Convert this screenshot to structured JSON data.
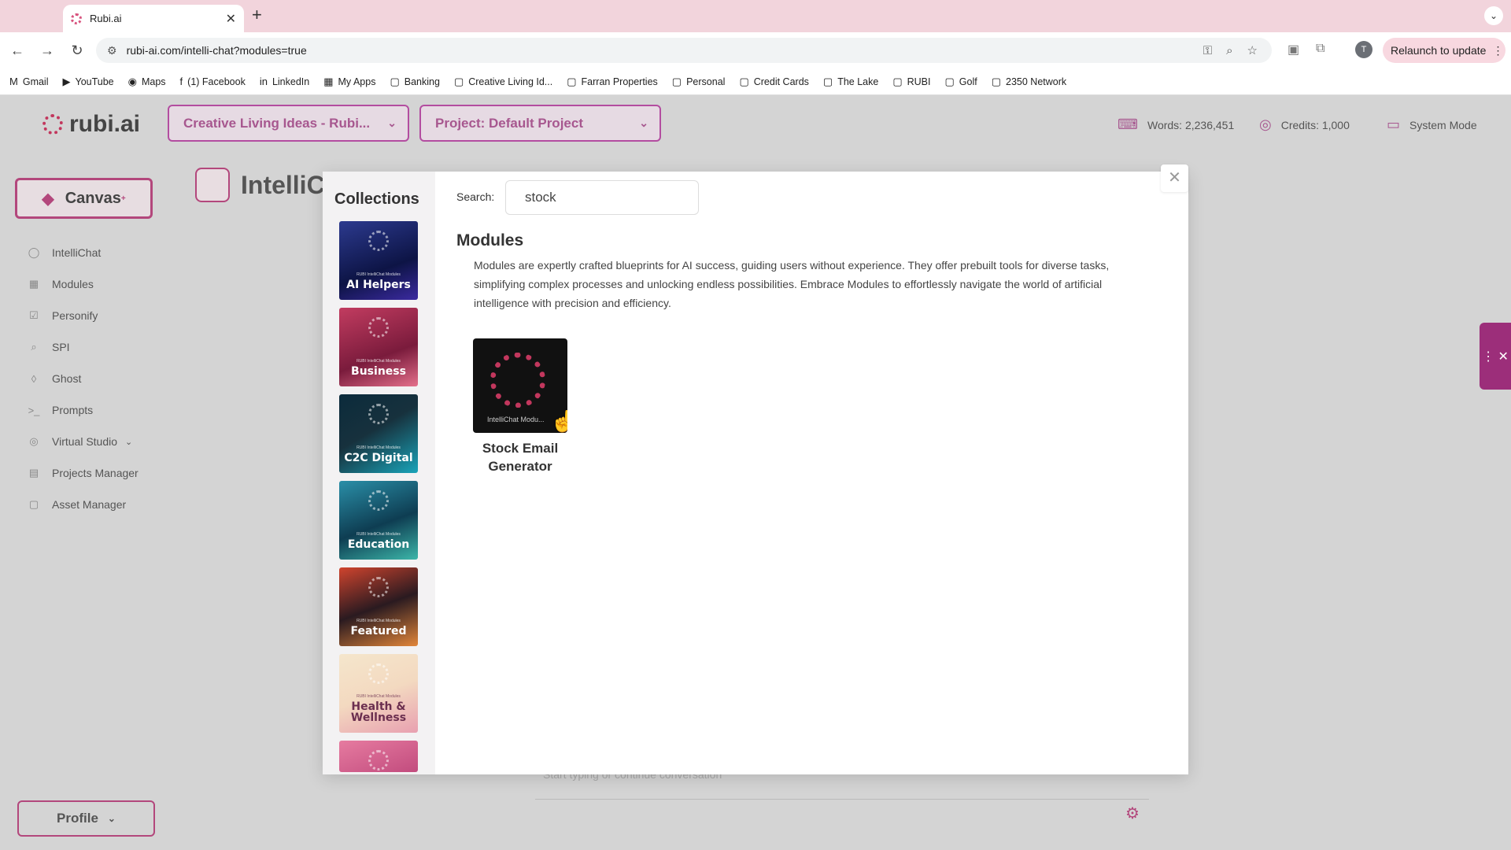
{
  "browser": {
    "tab_title": "Rubi.ai",
    "url": "rubi-ai.com/intelli-chat?modules=true",
    "relaunch_label": "Relaunch to update",
    "profile_initial": "T",
    "bookmarks": [
      {
        "label": "Gmail",
        "icon": "gmail-icon"
      },
      {
        "label": "YouTube",
        "icon": "youtube-icon"
      },
      {
        "label": "Maps",
        "icon": "maps-icon"
      },
      {
        "label": "(1) Facebook",
        "icon": "facebook-icon"
      },
      {
        "label": "LinkedIn",
        "icon": "linkedin-icon"
      },
      {
        "label": "My Apps",
        "icon": "apps-icon"
      },
      {
        "label": "Banking",
        "icon": "folder-icon"
      },
      {
        "label": "Creative Living Id...",
        "icon": "folder-icon"
      },
      {
        "label": "Farran Properties",
        "icon": "folder-icon"
      },
      {
        "label": "Personal",
        "icon": "folder-icon"
      },
      {
        "label": "Credit Cards",
        "icon": "folder-icon"
      },
      {
        "label": "The Lake",
        "icon": "folder-icon"
      },
      {
        "label": "RUBI",
        "icon": "folder-icon"
      },
      {
        "label": "Golf",
        "icon": "folder-icon"
      },
      {
        "label": "2350 Network",
        "icon": "folder-icon"
      }
    ]
  },
  "header": {
    "logo": "rubi.ai",
    "workspace": "Creative Living Ideas - Rubi...",
    "project": "Project: Default Project",
    "words": "Words: 2,236,451",
    "credits": "Credits: 1,000",
    "mode": "System Mode"
  },
  "sidebar": {
    "canvas_label": "Canvas",
    "canvas_sup": "+",
    "items": [
      {
        "label": "IntelliChat",
        "icon": "chat-icon"
      },
      {
        "label": "Modules",
        "icon": "modules-icon"
      },
      {
        "label": "Personify",
        "icon": "personify-icon"
      },
      {
        "label": "SPI",
        "icon": "spi-icon"
      },
      {
        "label": "Ghost",
        "icon": "ghost-icon"
      },
      {
        "label": "Prompts",
        "icon": "prompts-icon"
      },
      {
        "label": "Virtual Studio",
        "icon": "studio-icon"
      },
      {
        "label": "Projects Manager",
        "icon": "projects-icon"
      },
      {
        "label": "Asset Manager",
        "icon": "folder-icon"
      }
    ],
    "profile_label": "Profile"
  },
  "page": {
    "title": "IntelliC",
    "input_placeholder": "Start typing or continue conversation"
  },
  "modal": {
    "collections_title": "Collections",
    "collections": [
      {
        "sub": "RUBI IntelliChat Modules",
        "label": "AI Helpers"
      },
      {
        "sub": "RUBI IntelliChat Modules",
        "label": "Business"
      },
      {
        "sub": "RUBI IntelliChat Modules",
        "label": "C2C Digital"
      },
      {
        "sub": "RUBI IntelliChat Modules",
        "label": "Education"
      },
      {
        "sub": "RUBI IntelliChat Modules",
        "label": "Featured"
      },
      {
        "sub": "RUBI IntelliChat Modules",
        "label": "Health & Wellness"
      },
      {
        "sub": "",
        "label": ""
      }
    ],
    "search_label": "Search:",
    "search_value": "stock",
    "heading": "Modules",
    "description": "Modules are expertly crafted blueprints for AI success, guiding users without experience. They offer prebuilt tools for diverse tasks, simplifying complex processes and unlocking endless possibilities. Embrace Modules to effortlessly navigate the world of artificial intelligence with precision and efficiency.",
    "results": [
      {
        "title": "Stock Email Generator",
        "thumb_text": "IntelliChat Modu..."
      }
    ]
  },
  "colors": {
    "brand": "#c2375d",
    "accent": "#b3477c"
  }
}
